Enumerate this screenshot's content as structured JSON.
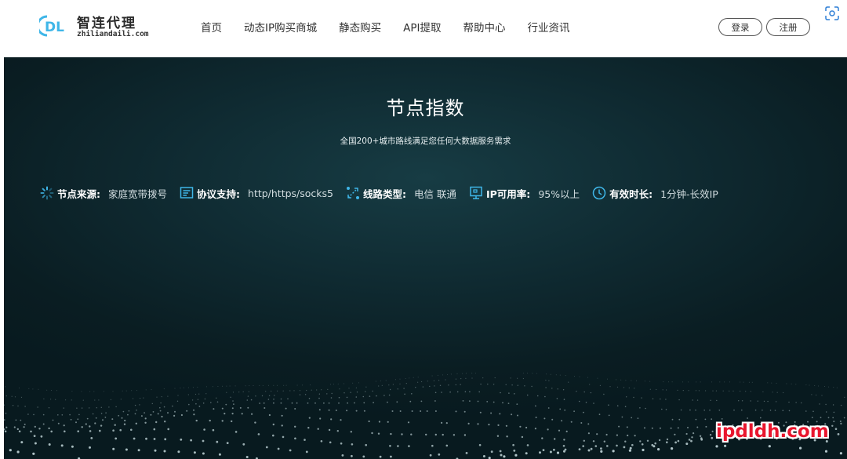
{
  "header": {
    "logo": {
      "cn": "智连代理",
      "en": "zhiliandaili.com",
      "mark_text": "DL"
    },
    "nav": [
      {
        "label": "首页"
      },
      {
        "label": "动态IP购买商城"
      },
      {
        "label": "静态购买"
      },
      {
        "label": "API提取"
      },
      {
        "label": "帮助中心"
      },
      {
        "label": "行业资讯"
      }
    ],
    "login_label": "登录",
    "register_label": "注册",
    "corner_icon": "scan-icon"
  },
  "hero": {
    "title": "节点指数",
    "subtitle": "全国200+城市路线满足您任何大数据服务需求",
    "features": [
      {
        "icon": "spinner-icon",
        "label": "节点来源:",
        "value": "家庭宽带拨号"
      },
      {
        "icon": "document-icon",
        "label": "协议支持:",
        "value": "http/https/socks5"
      },
      {
        "icon": "route-icon",
        "label": "线路类型:",
        "value": "电信 联通"
      },
      {
        "icon": "monitor-icon",
        "label": "IP可用率:",
        "value": "95%以上"
      },
      {
        "icon": "clock-icon",
        "label": "有效时长:",
        "value": "1分钟-长效IP"
      }
    ]
  },
  "watermark": "ipdldh.com",
  "colors": {
    "hero_bg": "#0f2a31",
    "accent": "#3fb6e8",
    "watermark": "#e8162e"
  }
}
